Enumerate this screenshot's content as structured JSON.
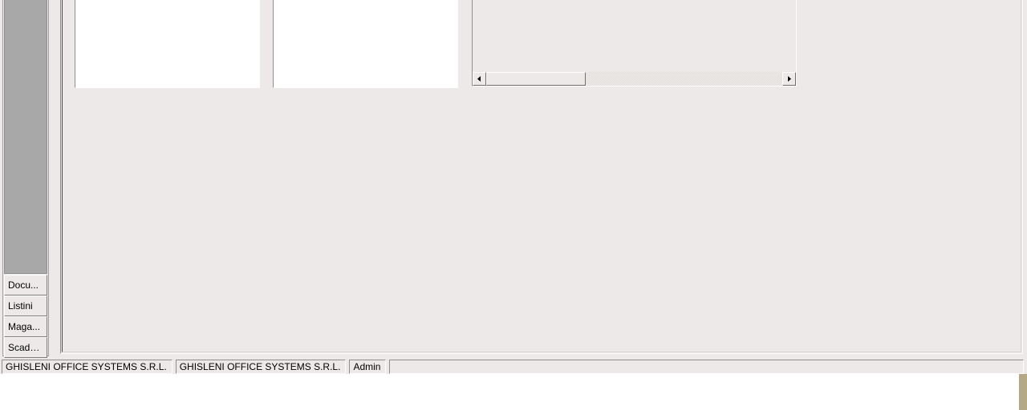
{
  "sidebar": {
    "items": [
      {
        "label": "Docu..."
      },
      {
        "label": "Listini"
      },
      {
        "label": "Maga..."
      },
      {
        "label": "Scade..."
      }
    ]
  },
  "statusbar": {
    "company1": "GHISLENI OFFICE SYSTEMS S.R.L.",
    "company2": "GHISLENI OFFICE SYSTEMS S.R.L.",
    "user": "Admin"
  }
}
